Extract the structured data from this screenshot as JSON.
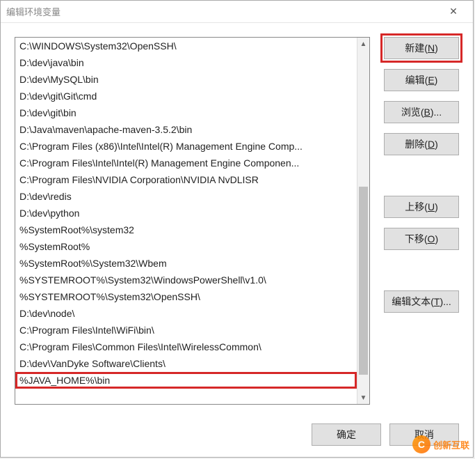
{
  "title": "编辑环境变量",
  "list_items": [
    "C:\\WINDOWS\\System32\\OpenSSH\\",
    "D:\\dev\\java\\bin",
    "D:\\dev\\MySQL\\bin",
    "D:\\dev\\git\\Git\\cmd",
    "D:\\dev\\git\\bin",
    "D:\\Java\\maven\\apache-maven-3.5.2\\bin",
    "C:\\Program Files (x86)\\Intel\\Intel(R) Management Engine Comp...",
    "C:\\Program Files\\Intel\\Intel(R) Management Engine Componen...",
    "C:\\Program Files\\NVIDIA Corporation\\NVIDIA NvDLISR",
    "D:\\dev\\redis",
    "D:\\dev\\python",
    "%SystemRoot%\\system32",
    "%SystemRoot%",
    "%SystemRoot%\\System32\\Wbem",
    "%SYSTEMROOT%\\System32\\WindowsPowerShell\\v1.0\\",
    "%SYSTEMROOT%\\System32\\OpenSSH\\",
    "D:\\dev\\node\\",
    "C:\\Program Files\\Intel\\WiFi\\bin\\",
    "C:\\Program Files\\Common Files\\Intel\\WirelessCommon\\",
    "D:\\dev\\VanDyke Software\\Clients\\",
    "%JAVA_HOME%\\bin"
  ],
  "highlighted_item_index": 20,
  "buttons": {
    "new": {
      "label": "新建",
      "accel": "N"
    },
    "edit": {
      "label": "编辑",
      "accel": "E"
    },
    "browse": {
      "label": "浏览",
      "accel": "B",
      "suffix": "..."
    },
    "delete": {
      "label": "删除",
      "accel": "D"
    },
    "move_up": {
      "label": "上移",
      "accel": "U"
    },
    "move_down": {
      "label": "下移",
      "accel": "O"
    },
    "edit_text": {
      "label": "编辑文本",
      "accel": "T",
      "suffix": "..."
    }
  },
  "footer": {
    "ok": "确定",
    "cancel": "取消"
  },
  "watermark": {
    "icon": "C",
    "text": "创新互联"
  }
}
